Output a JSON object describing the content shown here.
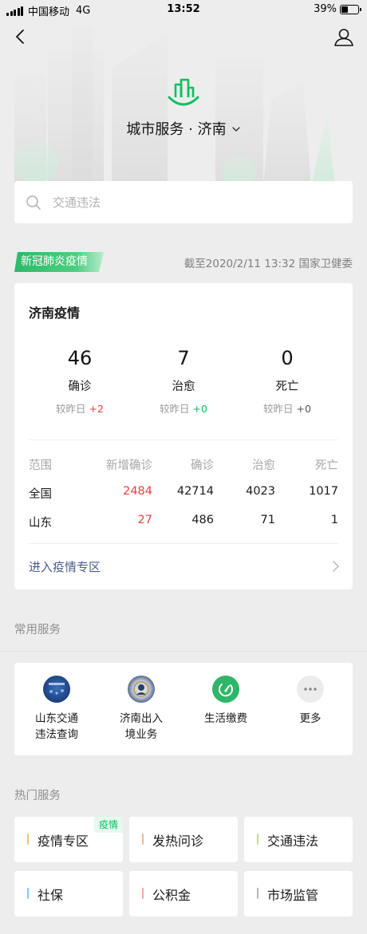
{
  "status_bar": {
    "carrier": "中国移动",
    "network": "4G",
    "time": "13:52",
    "battery": "39%",
    "battery_level": 0.39
  },
  "header": {
    "title": "城市服务 · 济南"
  },
  "search": {
    "placeholder": "交通违法"
  },
  "epidemic": {
    "tag": "新冠肺炎疫情",
    "source": "截至2020/2/11 13:32 国家卫健委",
    "card_title": "济南疫情",
    "stats": [
      {
        "value": "46",
        "label": "确诊",
        "delta_prefix": "较昨日",
        "delta": "+2"
      },
      {
        "value": "7",
        "label": "治愈",
        "delta_prefix": "较昨日",
        "delta": "+0"
      },
      {
        "value": "0",
        "label": "死亡",
        "delta_prefix": "较昨日",
        "delta": "+0"
      }
    ],
    "table": {
      "headers": [
        "范围",
        "新增确诊",
        "确诊",
        "治愈",
        "死亡"
      ],
      "rows": [
        [
          "全国",
          "2484",
          "42714",
          "4023",
          "1017"
        ],
        [
          "山东",
          "27",
          "486",
          "71",
          "1"
        ]
      ]
    },
    "enter_link": "进入疫情专区"
  },
  "common_services": {
    "title": "常用服务",
    "items": [
      {
        "line1": "山东交通",
        "line2": "违法查询"
      },
      {
        "line1": "济南出入",
        "line2": "境业务"
      },
      {
        "line1": "生活缴费",
        "line2": ""
      },
      {
        "line1": "更多",
        "line2": ""
      }
    ]
  },
  "hot_services": {
    "title": "热门服务",
    "items": [
      {
        "label": "疫情专区",
        "badge": "疫情",
        "color": "#f0c27a"
      },
      {
        "label": "发热问诊",
        "badge": "",
        "color": "#f3b98f"
      },
      {
        "label": "交通违法",
        "badge": "",
        "color": "#c5de83"
      },
      {
        "label": "社保",
        "badge": "",
        "color": "#86c9ee"
      },
      {
        "label": "公积金",
        "badge": "",
        "color": "#f0a99a"
      },
      {
        "label": "市场监管",
        "badge": "",
        "color": "#b9b9b9"
      }
    ]
  },
  "colors": {
    "accent": "#07c160",
    "alert": "#e64340",
    "link": "#4b5f8c"
  }
}
